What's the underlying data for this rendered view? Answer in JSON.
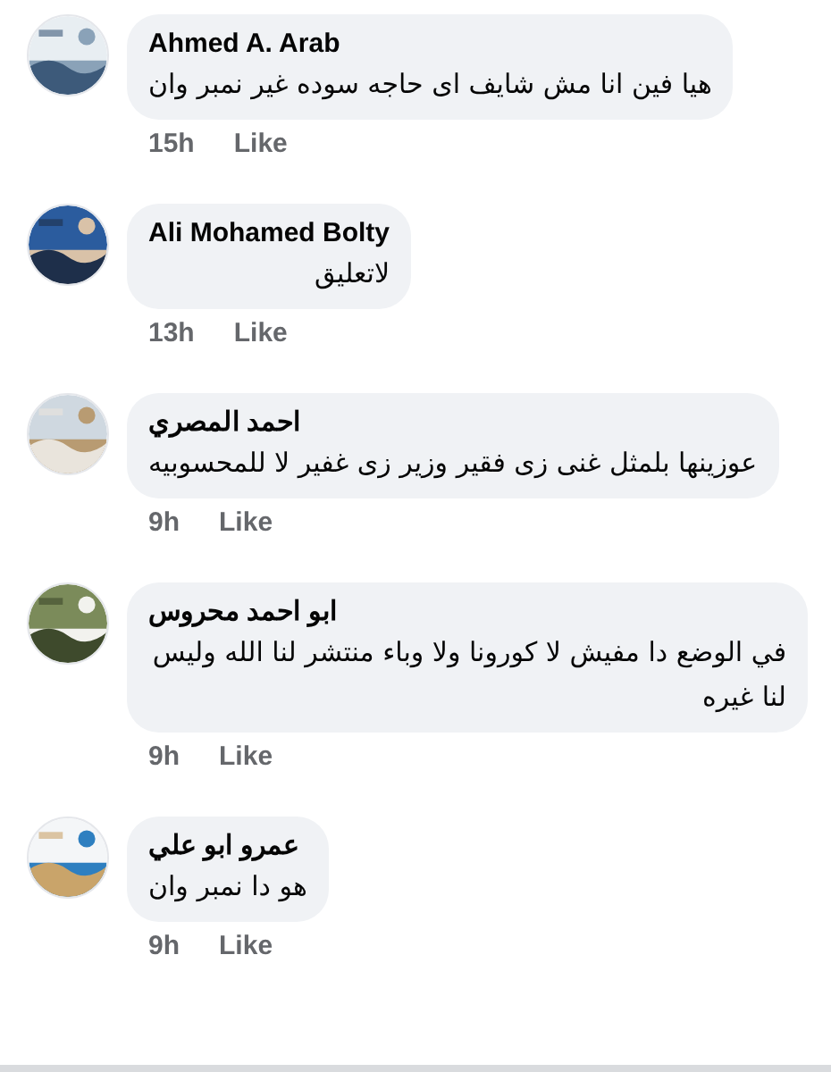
{
  "comments": [
    {
      "author": "Ahmed A. Arab",
      "text": "هيا فين انا مش شايف اى حاجه سوده غير نمبر وان",
      "time": "15h",
      "like": "Like"
    },
    {
      "author": "Ali Mohamed Bolty",
      "text": "لاتعليق",
      "time": "13h",
      "like": "Like"
    },
    {
      "author": "احمد المصري",
      "text": "عوزينها بلمثل غنى زى فقير وزير زى غفير لا للمحسوبيه",
      "time": "9h",
      "like": "Like"
    },
    {
      "author": "ابو احمد محروس",
      "text": "في الوضع دا مفيش لا كورونا ولا وباء منتشر لنا الله وليس لنا غيره",
      "time": "9h",
      "like": "Like"
    },
    {
      "author": "عمرو ابو علي",
      "text": "هو دا نمبر وان",
      "time": "9h",
      "like": "Like"
    }
  ]
}
